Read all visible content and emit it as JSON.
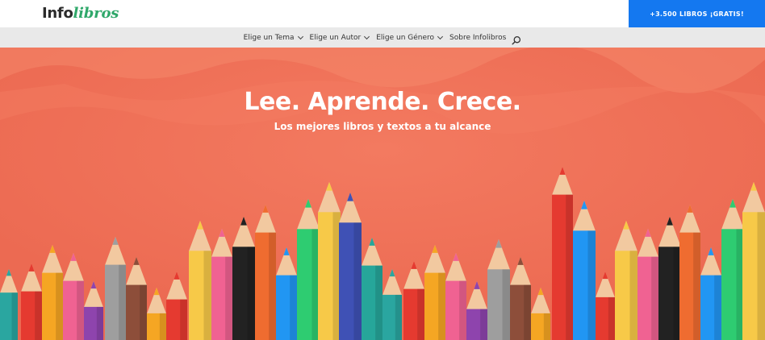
{
  "brand": {
    "logo_part1": "Info",
    "logo_part2": "libros",
    "logo_color": "#2fa86a"
  },
  "cta": {
    "label": "+3.500 LIBROS ¡GRATIS!",
    "color": "#1478f0"
  },
  "nav": {
    "items": [
      {
        "label": "Elige un Tema",
        "dropdown": true
      },
      {
        "label": "Elige un Autor",
        "dropdown": true
      },
      {
        "label": "Elige un Género",
        "dropdown": true
      },
      {
        "label": "Sobre Infolibros",
        "dropdown": false
      }
    ],
    "search_icon": "search-icon"
  },
  "hero": {
    "title": "Lee. Aprende. Crece.",
    "subtitle": "Los mejores libros y textos a tu alcance",
    "background_color": "#f07058",
    "image": "colored-pencils"
  }
}
